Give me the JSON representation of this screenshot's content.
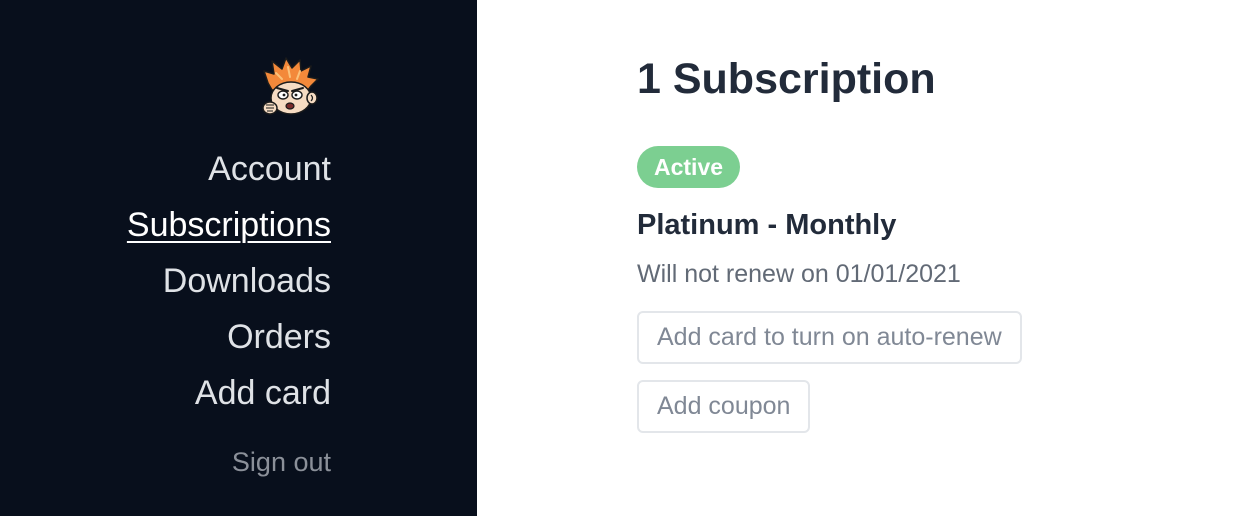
{
  "sidebar": {
    "avatar_icon": "cartoon-character-avatar",
    "nav": [
      {
        "label": "Account",
        "active": false
      },
      {
        "label": "Subscriptions",
        "active": true
      },
      {
        "label": "Downloads",
        "active": false
      },
      {
        "label": "Orders",
        "active": false
      },
      {
        "label": "Add card",
        "active": false
      }
    ],
    "signout_label": "Sign out",
    "background_color": "#080f1c"
  },
  "main": {
    "title": "1 Subscription",
    "subscription": {
      "status": "Active",
      "status_color": "#7ccf91",
      "plan": "Platinum - Monthly",
      "renewal_text": "Will not renew on 01/01/2021",
      "add_card_label": "Add card to turn on auto-renew",
      "add_coupon_label": "Add coupon"
    }
  }
}
